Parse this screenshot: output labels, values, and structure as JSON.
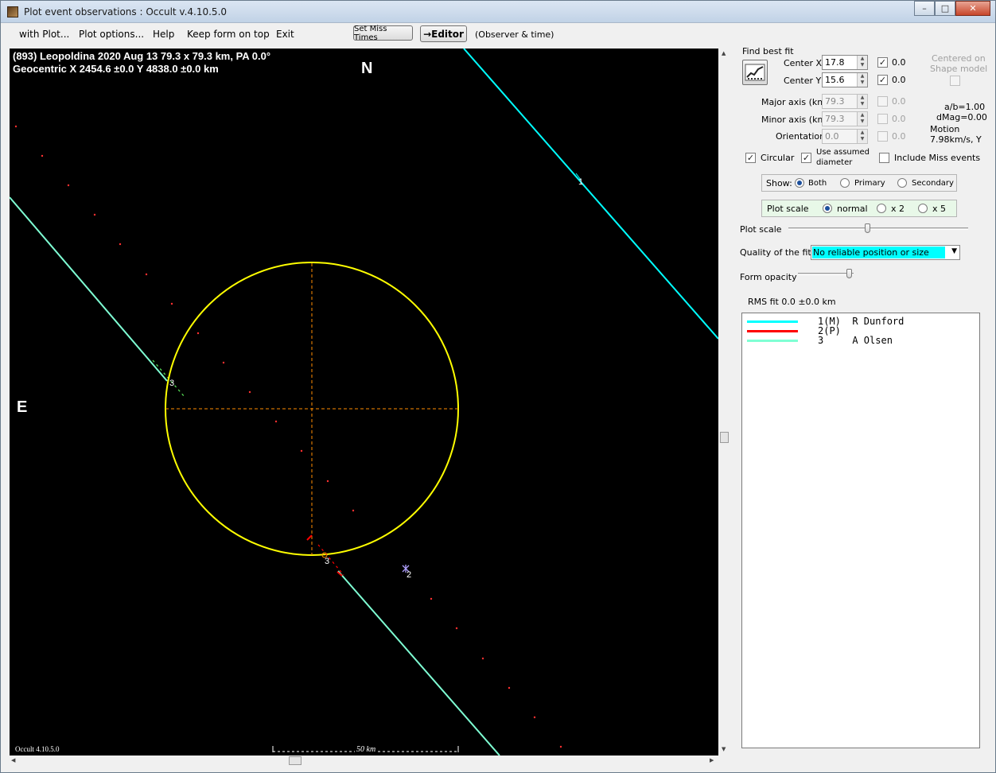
{
  "window": {
    "title": "Plot event observations : Occult v.4.10.5.0"
  },
  "menu": {
    "with_plot": "with Plot...",
    "plot_options": "Plot options...",
    "help": "Help",
    "keep_on_top": "Keep form on top",
    "exit": "Exit",
    "set_miss_times": "Set Miss Times",
    "editor": "→Editor",
    "observer_time": "(Observer & time)"
  },
  "plot": {
    "header_line1": "(893) Leopoldina  2020 Aug 13   79.3 x 79.3 km, PA 0.0°",
    "header_line2": "Geocentric  X  2454.6 ±0.0   Y 4838.0 ±0.0 km",
    "north_label": "N",
    "east_label": "E",
    "chord_labels": [
      "1",
      "2",
      "3",
      "3"
    ],
    "scale_label": "50 km",
    "footer": "Occult 4.10.5.0",
    "colors": {
      "background": "#000000",
      "ellipse": "#ffff00",
      "chord1": "#00ffff",
      "chord2": "#ff0000",
      "chord3": "#7fffd4",
      "axes": "#ff8c00"
    }
  },
  "panel": {
    "find_best_fit": "Find best fit",
    "center_x_label": "Center X",
    "center_x_value": "17.8",
    "center_x_unc": "0.0",
    "center_y_label": "Center Y",
    "center_y_value": "15.6",
    "center_y_unc": "0.0",
    "centered_on": "Centered on",
    "shape_model": "Shape model",
    "major_axis_label": "Major axis (km)",
    "major_axis_value": "79.3",
    "major_axis_unc": "0.0",
    "minor_axis_label": "Minor axis (km)",
    "minor_axis_value": "79.3",
    "minor_axis_unc": "0.0",
    "orientation_label": "Orientation",
    "orientation_value": "0.0",
    "orientation_unc": "0.0",
    "ab_ratio": "a/b=1.00",
    "dmag": "dMag=0.00",
    "motion_label": "Motion",
    "motion_value": "7.98km/s, Y",
    "circular": "Circular",
    "use_assumed_line1": "Use assumed",
    "use_assumed_line2": "diameter",
    "include_miss": "Include Miss events",
    "show_label": "Show:",
    "show_both": "Both",
    "show_primary": "Primary",
    "show_secondary": "Secondary",
    "plot_scale_group": "Plot scale",
    "scale_normal": "normal",
    "scale_x2": "x 2",
    "scale_x5": "x 5",
    "plot_scale_slider": "Plot scale",
    "quality_label": "Quality of the fit",
    "quality_value": "No reliable position or size",
    "form_opacity": "Form opacity",
    "rms_fit": "RMS fit  0.0 ±0.0 km",
    "legend": [
      {
        "text": "1(M)  R Dunford",
        "color": "#00ffff"
      },
      {
        "text": "2(P)",
        "color": "#ff0000"
      },
      {
        "text": "3     A Olsen",
        "color": "#7fffd4"
      }
    ]
  }
}
